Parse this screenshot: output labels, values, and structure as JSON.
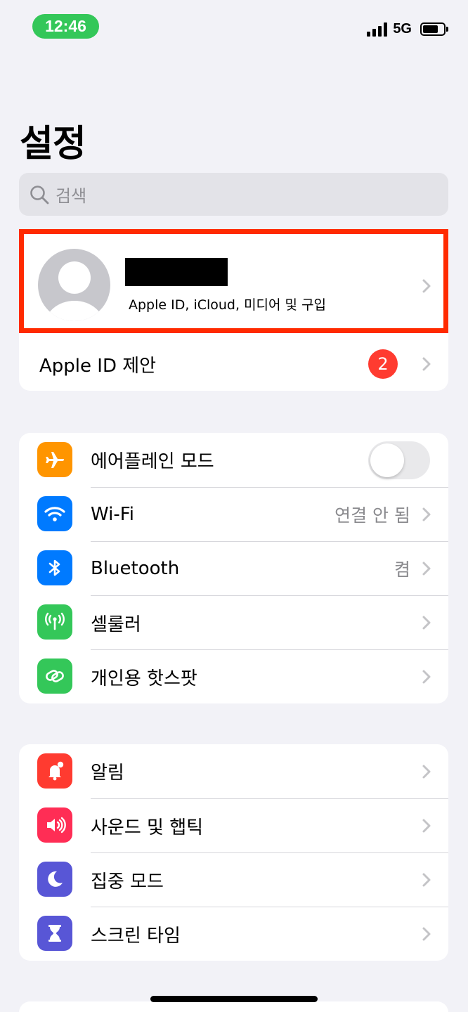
{
  "status_bar": {
    "time": "12:46",
    "network": "5G",
    "time_pill_color": "#34c759"
  },
  "page_title": "설정",
  "search": {
    "placeholder": "검색"
  },
  "profile": {
    "subtitle": "Apple ID, iCloud, 미디어 및 구입",
    "name_redacted": true,
    "highlight_color": "#ff2a00"
  },
  "apple_id_suggestions": {
    "label": "Apple ID 제안",
    "badge": "2"
  },
  "network_group": [
    {
      "label": "에어플레인 모드",
      "icon": "airplane-icon",
      "icon_color": "#ff9500",
      "toggle": "off"
    },
    {
      "label": "Wi-Fi",
      "icon": "wifi-icon",
      "icon_color": "#007aff",
      "value": "연결 안 됨"
    },
    {
      "label": "Bluetooth",
      "icon": "bluetooth-icon",
      "icon_color": "#007aff",
      "value": "켬"
    },
    {
      "label": "셀룰러",
      "icon": "cellular-icon",
      "icon_color": "#34c759"
    },
    {
      "label": "개인용 핫스팟",
      "icon": "hotspot-icon",
      "icon_color": "#34c759"
    }
  ],
  "notify_group": [
    {
      "label": "알림",
      "icon": "notifications-icon",
      "icon_color": "#ff3b30"
    },
    {
      "label": "사운드 및 햅틱",
      "icon": "sound-icon",
      "icon_color": "#ff2d55"
    },
    {
      "label": "집중 모드",
      "icon": "moon-icon",
      "icon_color": "#5856d6"
    },
    {
      "label": "스크린 타임",
      "icon": "hourglass-icon",
      "icon_color": "#5856d6"
    }
  ]
}
